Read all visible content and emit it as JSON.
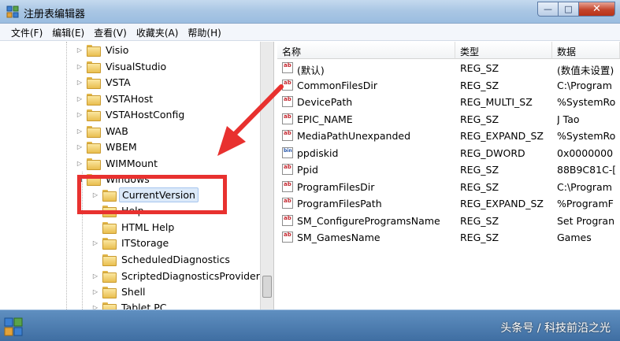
{
  "window": {
    "title": "注册表编辑器"
  },
  "titlebar": {
    "minimize": "—",
    "maximize": "□",
    "close": "✕"
  },
  "menu": [
    "文件(F)",
    "编辑(E)",
    "查看(V)",
    "收藏夹(A)",
    "帮助(H)"
  ],
  "tree": {
    "items": [
      {
        "label": "Visio",
        "toggle": "▷"
      },
      {
        "label": "VisualStudio",
        "toggle": "▷"
      },
      {
        "label": "VSTA",
        "toggle": "▷"
      },
      {
        "label": "VSTAHost",
        "toggle": "▷"
      },
      {
        "label": "VSTAHostConfig",
        "toggle": "▷"
      },
      {
        "label": "WAB",
        "toggle": "▷"
      },
      {
        "label": "WBEM",
        "toggle": "▷"
      },
      {
        "label": "WIMMount",
        "toggle": "▷"
      },
      {
        "label": "Windows",
        "toggle": "◢"
      },
      {
        "label": "CurrentVersion",
        "toggle": "▷",
        "selected": true
      },
      {
        "label": "Help",
        "toggle": ""
      },
      {
        "label": "HTML Help",
        "toggle": ""
      },
      {
        "label": "ITStorage",
        "toggle": "▷"
      },
      {
        "label": "ScheduledDiagnostics",
        "toggle": ""
      },
      {
        "label": "ScriptedDiagnosticsProvider",
        "toggle": "▷"
      },
      {
        "label": "Shell",
        "toggle": "▷"
      },
      {
        "label": "Tablet PC",
        "toggle": "▷"
      }
    ]
  },
  "values": {
    "columns": [
      "名称",
      "类型",
      "数据"
    ],
    "rows": [
      {
        "name": "(默认)",
        "type": "REG_SZ",
        "data": "(数值未设置)",
        "icon": "ab"
      },
      {
        "name": "CommonFilesDir",
        "type": "REG_SZ",
        "data": "C:\\Program",
        "icon": "ab"
      },
      {
        "name": "DevicePath",
        "type": "REG_MULTI_SZ",
        "data": "%SystemRo",
        "icon": "ab"
      },
      {
        "name": "EPIC_NAME",
        "type": "REG_SZ",
        "data": "J Tao",
        "icon": "ab"
      },
      {
        "name": "MediaPathUnexpanded",
        "type": "REG_EXPAND_SZ",
        "data": "%SystemRo",
        "icon": "ab"
      },
      {
        "name": "ppdiskid",
        "type": "REG_DWORD",
        "data": "0x0000000",
        "icon": "bin"
      },
      {
        "name": "Ppid",
        "type": "REG_SZ",
        "data": "88B9C81C-[",
        "icon": "ab"
      },
      {
        "name": "ProgramFilesDir",
        "type": "REG_SZ",
        "data": "C:\\Program",
        "icon": "ab"
      },
      {
        "name": "ProgramFilesPath",
        "type": "REG_EXPAND_SZ",
        "data": "%ProgramF",
        "icon": "ab"
      },
      {
        "name": "SM_ConfigureProgramsName",
        "type": "REG_SZ",
        "data": "Set Progran",
        "icon": "ab"
      },
      {
        "name": "SM_GamesName",
        "type": "REG_SZ",
        "data": "Games",
        "icon": "ab"
      }
    ]
  },
  "watermark": "头条号 / 科技前沿之光",
  "colors": {
    "annotation": "#e8312f",
    "selection": "#dbe9f9",
    "titlebar": "#a9c6e4"
  }
}
